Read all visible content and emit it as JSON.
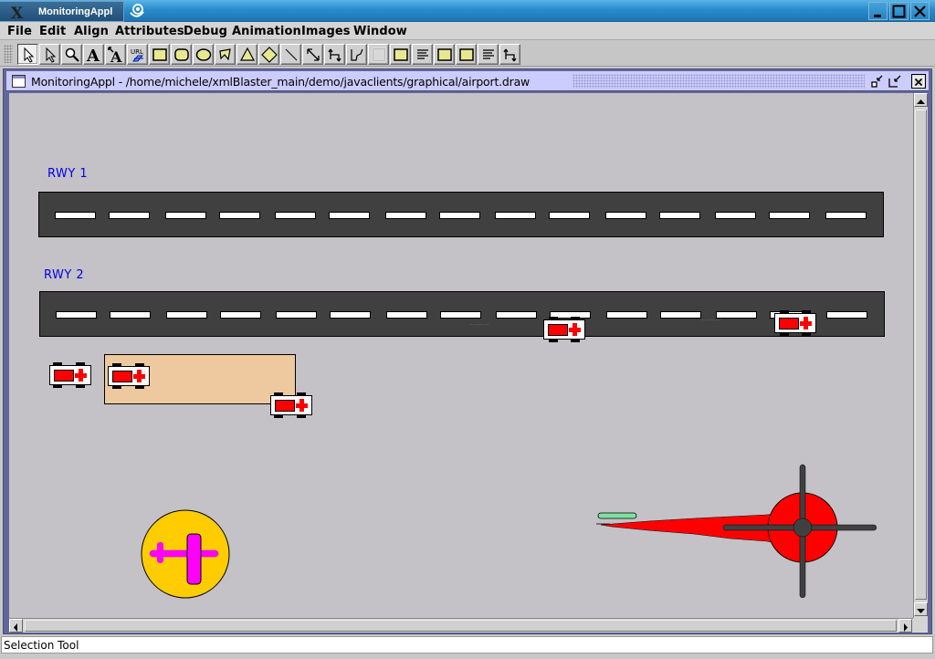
{
  "os_window": {
    "title": "MonitoringAppl",
    "controls": [
      "minimize",
      "maximize",
      "close"
    ]
  },
  "menubar": {
    "items": [
      "File",
      "Edit",
      "Align",
      "Attributes",
      "Debug",
      "Animation",
      "Images",
      "Window"
    ]
  },
  "toolbar": {
    "tools": [
      {
        "name": "selection-tool",
        "icon": "arrow-cursor-icon",
        "active": true
      },
      {
        "name": "direct-select-tool",
        "icon": "hollow-arrow-icon"
      },
      {
        "name": "zoom-tool",
        "icon": "magnifier-icon"
      },
      {
        "name": "text-tool",
        "icon": "letter-a-icon"
      },
      {
        "name": "connected-text-tool",
        "icon": "connected-letter-a-icon"
      },
      {
        "name": "url-tool",
        "icon": "url-link-icon"
      },
      {
        "name": "rectangle-tool",
        "icon": "rectangle-icon"
      },
      {
        "name": "round-rectangle-tool",
        "icon": "round-rectangle-icon"
      },
      {
        "name": "ellipse-tool",
        "icon": "ellipse-icon"
      },
      {
        "name": "polygon-tool",
        "icon": "polygon-icon"
      },
      {
        "name": "triangle-tool",
        "icon": "triangle-icon"
      },
      {
        "name": "diamond-tool",
        "icon": "diamond-icon"
      },
      {
        "name": "line-tool",
        "icon": "line-icon"
      },
      {
        "name": "connection-tool",
        "icon": "double-arrow-line-icon"
      },
      {
        "name": "elbow-connection-tool",
        "icon": "elbow-connector-icon"
      },
      {
        "name": "scribble-tool",
        "icon": "scribble-icon"
      },
      {
        "name": "border-tool",
        "icon": "border-rect-icon"
      },
      {
        "name": "image-rect-tool",
        "icon": "rectangle-icon"
      },
      {
        "name": "text-area-tool",
        "icon": "text-lines-icon"
      },
      {
        "name": "image-rect-tool-2",
        "icon": "rectangle-icon"
      },
      {
        "name": "image-rect-tool-3",
        "icon": "rectangle-icon"
      },
      {
        "name": "text-area-tool-2",
        "icon": "text-lines-icon"
      },
      {
        "name": "elbow-connection-tool-2",
        "icon": "elbow-connector-icon"
      }
    ]
  },
  "internal_frame": {
    "title": "MonitoringAppl  -  /home/michele/xmlBlaster_main/demo/javaclients/graphical/airport.draw",
    "controls": [
      "iconify",
      "restore",
      "close"
    ]
  },
  "drawing": {
    "runways": [
      {
        "label": "RWY 1",
        "stripe_count": 15
      },
      {
        "label": "RWY 2",
        "stripe_count": 15
      }
    ],
    "colors": {
      "canvas": "#c4c2c6",
      "runway": "#404040",
      "label": "#0000ee",
      "ambulance_red": "#ff0000",
      "gate": "#eec9a0",
      "plane_badge": "#ffcc00",
      "plane_icon": "#ff00ff",
      "radar": "#ff0000",
      "radar_arms": "#404040",
      "radar_indicator": "#80e0a0"
    },
    "ambulances": [
      {
        "id": "ambulance-rwy2-mid"
      },
      {
        "id": "ambulance-rwy2-right"
      },
      {
        "id": "ambulance-left"
      },
      {
        "id": "ambulance-gate"
      },
      {
        "id": "ambulance-gate-corner"
      }
    ]
  },
  "statusbar": {
    "text": "Selection Tool"
  }
}
